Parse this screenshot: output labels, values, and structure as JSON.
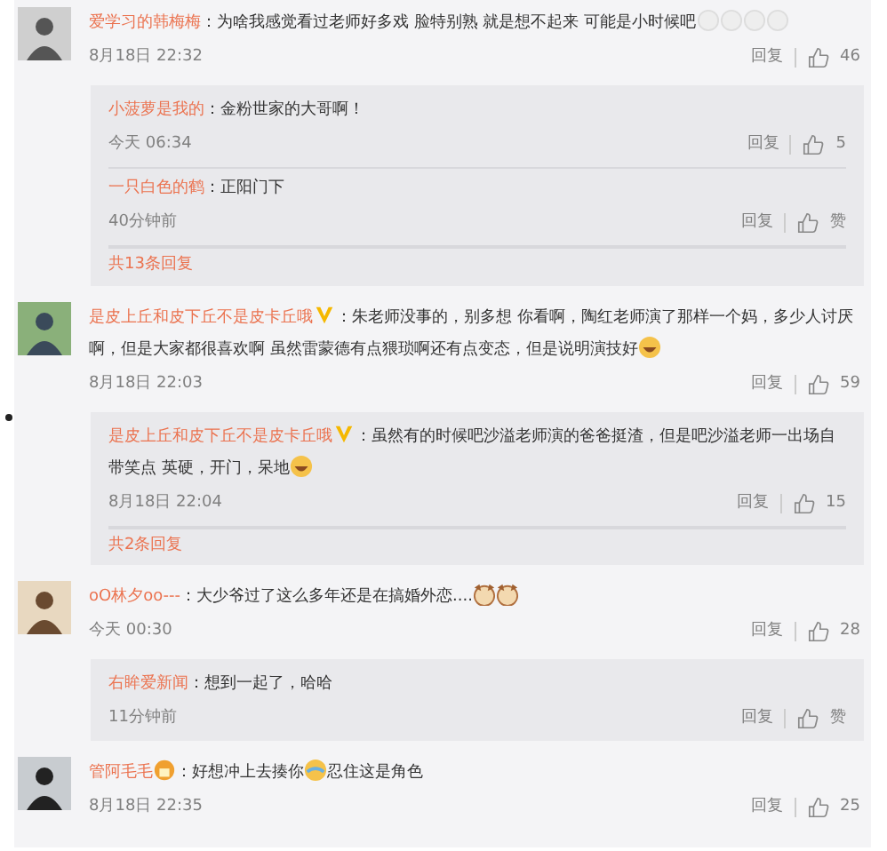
{
  "comments": [
    {
      "user": "爱学习的韩梅梅",
      "text": "：为啥我感觉看过老师好多戏 脸特别熟 就是想不起来 可能是小时候吧",
      "emoji": [
        {
          "kind": "ghost"
        },
        {
          "kind": "ghost"
        },
        {
          "kind": "ghost"
        },
        {
          "kind": "ghost"
        }
      ],
      "time": "8月18日 22:32",
      "reply": "回复",
      "likes": "46",
      "replies": [
        {
          "user": "小菠萝是我的",
          "text": "：金粉世家的大哥啊！",
          "time": "今天 06:34",
          "reply": "回复",
          "likes": "5"
        },
        {
          "user": "一只白色的鹤",
          "text": "：正阳门下",
          "time": "40分钟前",
          "reply": "回复",
          "likes": "赞"
        }
      ],
      "more": "共13条回复"
    },
    {
      "user": "是皮上丘和皮下丘不是皮卡丘哦",
      "badge": {
        "kind": "verified"
      },
      "text": "：朱老师没事的，别多想 你看啊，陶红老师演了那样一个妈，多少人讨厌啊，但是大家都很喜欢啊 虽然雷蒙德有点猥琐啊还有点变态，但是说明演技好",
      "emoji": [
        {
          "kind": "laugh"
        }
      ],
      "time": "8月18日 22:03",
      "reply": "回复",
      "likes": "59",
      "replies": [
        {
          "user": "是皮上丘和皮下丘不是皮卡丘哦",
          "badge": {
            "kind": "verified"
          },
          "text": "：虽然有的时候吧沙溢老师演的爸爸挺渣，但是吧沙溢老师一出场自带笑点 英硬，开门，呆地",
          "emoji": [
            {
              "kind": "laugh"
            }
          ],
          "time": "8月18日 22:04",
          "reply": "回复",
          "likes": "15"
        }
      ],
      "more": "共2条回复"
    },
    {
      "user": "oO林夕oo---",
      "text": "：大少爷过了这么多年还是在搞婚外恋....",
      "emoji": [
        {
          "kind": "dog"
        },
        {
          "kind": "dog"
        }
      ],
      "time": "今天 00:30",
      "reply": "回复",
      "likes": "28",
      "replies": [
        {
          "user": "右眸爱新闻",
          "text": "：想到一起了，哈哈",
          "time": "11分钟前",
          "reply": "回复",
          "likes": "赞"
        }
      ]
    },
    {
      "user": "管阿毛毛",
      "badge": {
        "kind": "vip"
      },
      "text": "：好想冲上去揍你",
      "emoji": [
        {
          "kind": "cry"
        }
      ],
      "text2": "忍住这是角色",
      "time": "8月18日 22:35",
      "reply": "回复",
      "likes": "25"
    }
  ]
}
